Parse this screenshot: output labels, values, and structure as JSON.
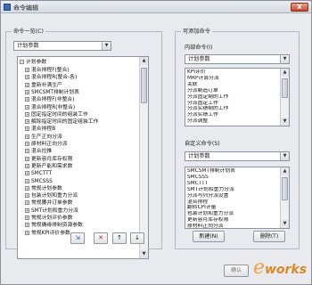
{
  "window": {
    "title": "命令编辑",
    "close_glyph": "X"
  },
  "left_panel": {
    "group_title": "命令一览(C)",
    "combo_value": "计划参数",
    "tree_root": "计划参数",
    "tree_items": [
      "混合排程F(整合)",
      "混合排程R(整合-各)",
      "重新补满生产",
      "SMCSMT排制计划表",
      "混合排程F(非整合)",
      "混合排程R(非整合)",
      "固定指定时间的组装工作",
      "解除指定时间的固定组装工作",
      "混合排程B",
      "生产正向分派",
      "原材料正向分派",
      "混合拉推",
      "更新容月库存权限",
      "更新产能和需求数",
      "SMCTTT",
      "SMCSSS",
      "常规计划参数",
      "包装计划和重力分派",
      "常规腰井订单参数",
      "SMT计划和重力分派",
      "常规计划评价参数",
      "常规确缘排制资源参数",
      "常规KPI评价参数"
    ],
    "toolbar_glyphs": [
      "⇲",
      "✕",
      "↑",
      "↓"
    ]
  },
  "right_panel": {
    "group_title": "可添加命令",
    "builtin_label": "内部命令(I)",
    "builtin_combo_value": "计划参数",
    "builtin_items": [
      "KPI评价",
      "MRP计算分派",
      "关联",
      "分派制造订单",
      "分派固定制的工作",
      "分派固定工作",
      "分派实绩制的工作",
      "分派实绩工作",
      "分派调整"
    ],
    "custom_label": "自定义命令(S)",
    "custom_combo_value": "计划参数",
    "custom_items": [
      "SMCSMT排制计划表",
      "SMCSSS",
      "SMCTTT",
      "SMT计划和重力分派",
      "分派与列分派设置",
      "混合排程",
      "翻转CPI计量",
      "包装计划和重力分派",
      "更新容月库存权限",
      "原材料正向分派"
    ],
    "new_button": "新建(N)",
    "delete_button": "删除(T)"
  },
  "footer": {
    "ok_button": "确认",
    "watermark_e": "e",
    "watermark_works": "works"
  },
  "colors": {
    "dialog_bg": "#e9eaed",
    "close_red": "#c7452d",
    "watermark_orange": "#f2a23a"
  }
}
